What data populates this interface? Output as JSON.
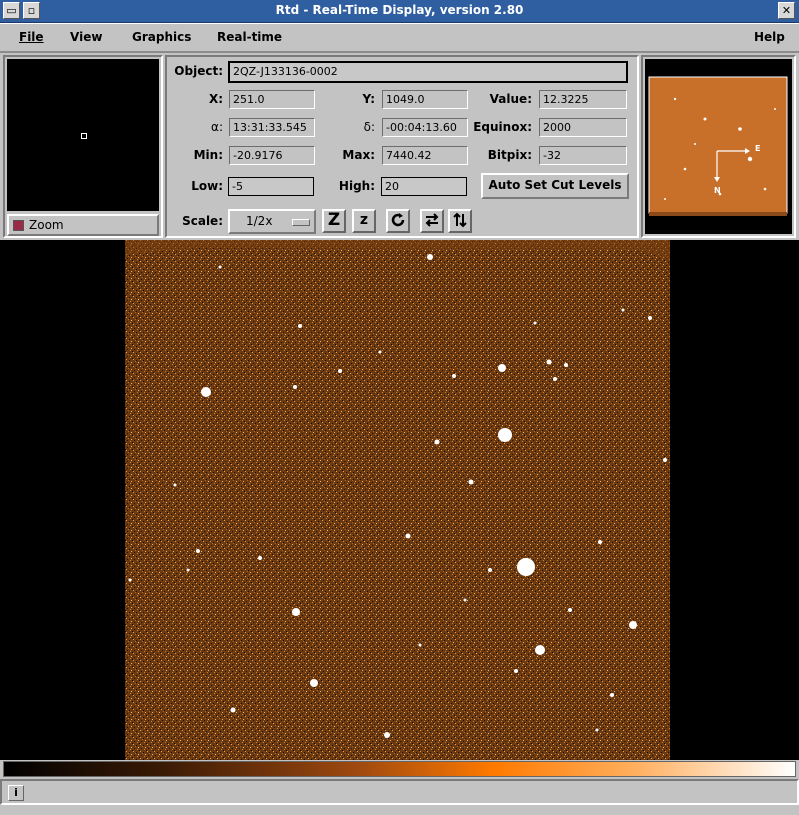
{
  "window": {
    "title": "Rtd - Real-Time Display, version 2.80"
  },
  "menu": [
    "File",
    "View",
    "Graphics",
    "Real-time",
    "Help"
  ],
  "zoom": {
    "label": "Zoom"
  },
  "info": {
    "object_label": "Object:",
    "object_value": "2QZ-J133136-0002",
    "x_label": "X:",
    "x_value": "251.0",
    "y_label": "Y:",
    "y_value": "1049.0",
    "value_label": "Value:",
    "value_value": "12.3225",
    "alpha_label": "α:",
    "alpha_value": "13:31:33.545",
    "delta_label": "δ:",
    "delta_value": "-00:04:13.60",
    "equinox_label": "Equinox:",
    "equinox_value": "2000",
    "min_label": "Min:",
    "min_value": "-20.9176",
    "max_label": "Max:",
    "max_value": "7440.42",
    "bitpix_label": "Bitpix:",
    "bitpix_value": "-32",
    "low_label": "Low:",
    "low_value": "-5",
    "high_label": "High:",
    "high_value": "20",
    "auto_cut_label": "Auto Set Cut Levels",
    "scale_label": "Scale:",
    "scale_value": "1/2x"
  },
  "toolbar": {
    "zoom_in": "Z",
    "zoom_out": "z"
  },
  "panner": {
    "east": "E",
    "north": "N"
  },
  "status": {
    "info_icon": "i"
  },
  "colors": {
    "image_tint": "#c8702a",
    "colorbar_mid": "#ff7a00"
  }
}
